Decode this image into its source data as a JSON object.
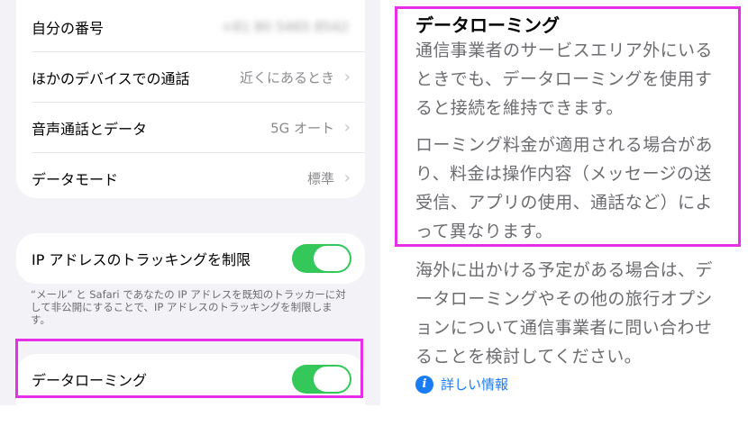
{
  "settings": {
    "rows": [
      {
        "label": "自分の番号",
        "value": "+81 80 5465 8542",
        "chevron": false
      },
      {
        "label": "ほかのデバイスでの通話",
        "value": "近くにあるとき",
        "chevron": true
      },
      {
        "label": "音声通話とデータ",
        "value": "5G オート",
        "chevron": true
      },
      {
        "label": "データモード",
        "value": "標準",
        "chevron": true
      }
    ],
    "ip_tracking": {
      "label": "IP アドレスのトラッキングを制限",
      "on": true
    },
    "footnote": "“メール” と Safari であなたの IP アドレスを既知のトラッカーに対して非公開にすることで、IP アドレスのトラッキングを制限します。",
    "data_roaming": {
      "label": "データローミング",
      "on": true
    }
  },
  "help": {
    "title": "データローミング",
    "para1": "通信事業者のサービスエリア外にいるときでも、データローミングを使用すると接続を維持できます。",
    "para2": "ローミング料金が適用される場合があり、料金は操作内容（メッセージの送受信、アプリの使用、通話など）によって異なります。",
    "para3": "海外に出かける予定がある場合は、データローミングやその他の旅行オプションについて通信事業者に問い合わせることを検討してください。",
    "more_link": "詳しい情報",
    "chevron_glyph": "›",
    "info_glyph": "i"
  },
  "colors": {
    "toggle_on": "#34c759",
    "highlight": "#e82ee8",
    "link": "#1a7cf5"
  }
}
